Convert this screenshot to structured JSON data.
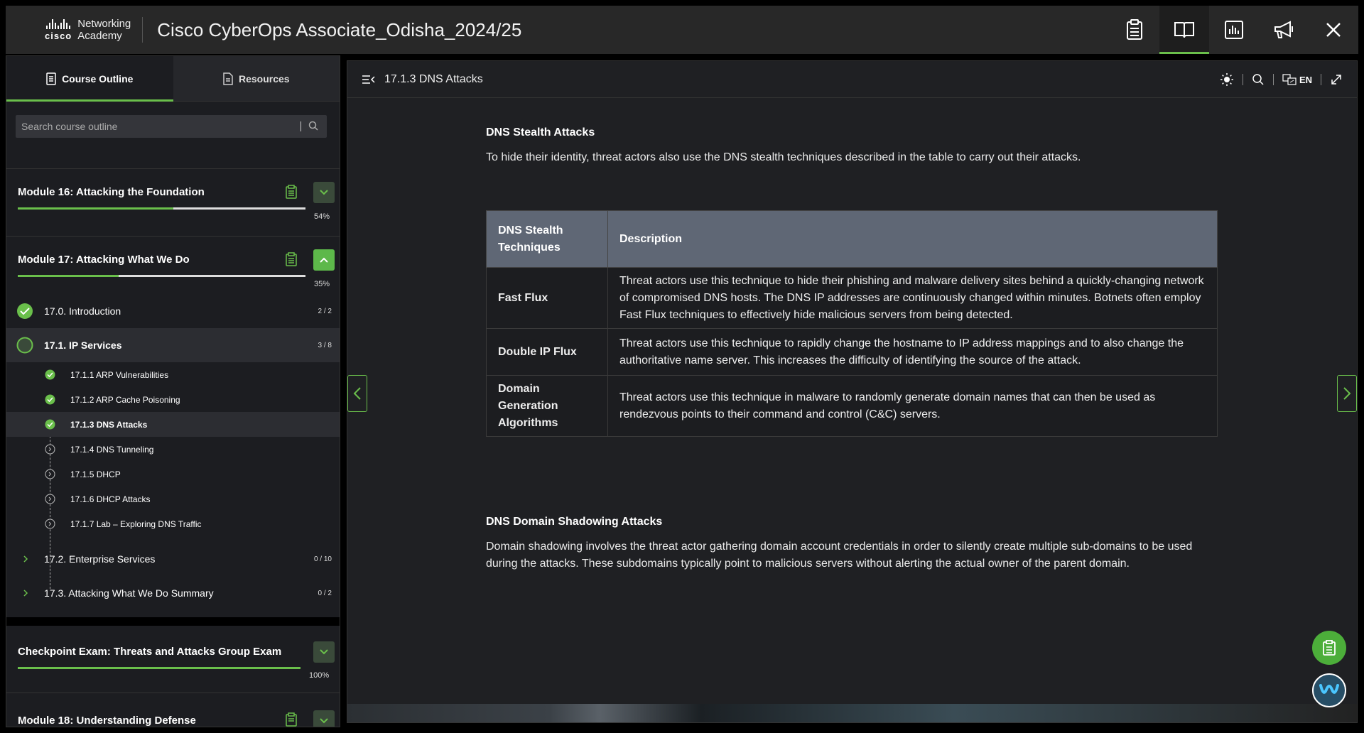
{
  "header": {
    "logo_line1": "Networking",
    "logo_line2": "Academy",
    "logo_brand": "cisco",
    "course_title": "Cisco CyberOps Associate_Odisha_2024/25",
    "icons": [
      "clipboard-icon",
      "book-icon",
      "chart-icon",
      "megaphone-icon",
      "close-icon"
    ],
    "active_icon": "book-icon"
  },
  "sidebar": {
    "tabs": [
      {
        "label": "Course Outline",
        "icon": "outline-icon",
        "active": true
      },
      {
        "label": "Resources",
        "icon": "document-icon",
        "active": false
      }
    ],
    "search_placeholder": "Search course outline",
    "modules": [
      {
        "title": "Module 16: Attacking the Foundation",
        "percent_label": "54%",
        "progress": 0.54,
        "expanded": false
      },
      {
        "title": "Module 17: Attacking What We Do",
        "percent_label": "35%",
        "progress": 0.35,
        "expanded": true
      },
      {
        "title": "Checkpoint Exam: Threats and Attacks Group Exam",
        "percent_label": "100%",
        "progress": 1.0,
        "expanded": false
      },
      {
        "title": "Module 18: Understanding Defense",
        "percent_label": "",
        "progress": 0,
        "expanded": false
      }
    ],
    "lessons": [
      {
        "label": "17.0. Introduction",
        "count": "2 / 2",
        "status": "complete"
      },
      {
        "label": "17.1. IP Services",
        "count": "3 / 8",
        "status": "in-progress",
        "active": true
      },
      {
        "label": "17.2. Enterprise Services",
        "count": "0 / 10",
        "status": "collapsed"
      },
      {
        "label": "17.3. Attacking What We Do Summary",
        "count": "0 / 2",
        "status": "collapsed"
      }
    ],
    "topics": [
      {
        "label": "17.1.1 ARP Vulnerabilities",
        "status": "complete"
      },
      {
        "label": "17.1.2 ARP Cache Poisoning",
        "status": "complete"
      },
      {
        "label": "17.1.3 DNS Attacks",
        "status": "complete",
        "active": true
      },
      {
        "label": "17.1.4 DNS Tunneling",
        "status": "pending"
      },
      {
        "label": "17.1.5 DHCP",
        "status": "pending"
      },
      {
        "label": "17.1.6 DHCP Attacks",
        "status": "pending"
      },
      {
        "label": "17.1.7 Lab – Exploring DNS Traffic",
        "status": "pending"
      }
    ]
  },
  "content": {
    "page_title": "17.1.3 DNS Attacks",
    "language": "EN",
    "section1_heading": "DNS Stealth Attacks",
    "section1_text": "To hide their identity, threat actors also use the DNS stealth techniques described in the table to carry out their attacks.",
    "table": {
      "headers": [
        "DNS Stealth Techniques",
        "Description"
      ],
      "rows": [
        {
          "technique": "Fast Flux",
          "description": "Threat actors use this technique to hide their phishing and malware delivery sites behind a quickly-changing network of compromised DNS hosts. The DNS IP addresses are continuously changed within minutes. Botnets often employ Fast Flux techniques to effectively hide malicious servers from being detected."
        },
        {
          "technique": "Double IP Flux",
          "description": "Threat actors use this technique to rapidly change the hostname to IP address mappings and to also change the authoritative name server. This increases the difficulty of identifying the source of the attack."
        },
        {
          "technique": "Domain Generation Algorithms",
          "description": "Threat actors use this technique in malware to randomly generate domain names that can then be used as rendezvous points to their command and control (C&C) servers."
        }
      ]
    },
    "section2_heading": "DNS Domain Shadowing Attacks",
    "section2_text": "Domain shadowing involves the threat actor gathering domain account credentials in order to silently create multiple sub-domains to be used during the attacks. These subdomains typically point to malicious servers without alerting the actual owner of the parent domain."
  },
  "colors": {
    "accent": "#6abf4b",
    "table_header": "#5f6775",
    "panel": "#1f2023"
  }
}
